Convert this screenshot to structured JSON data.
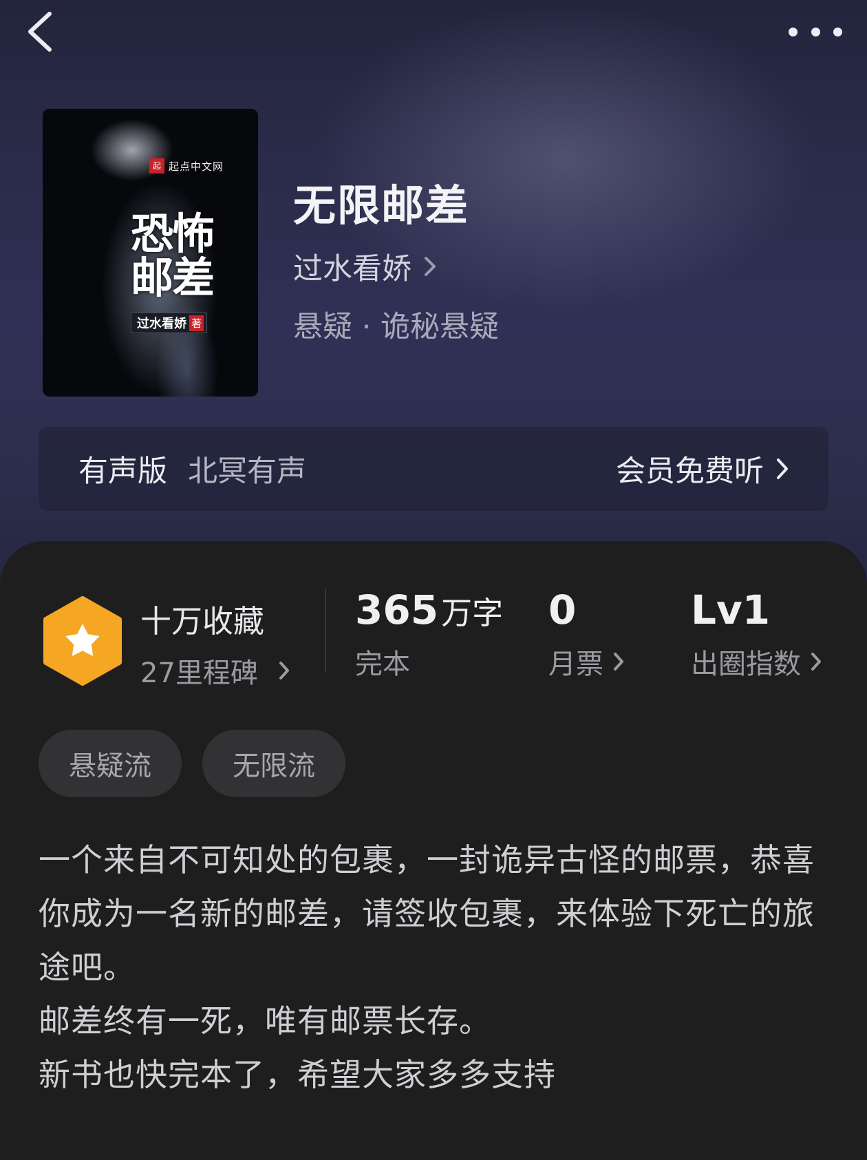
{
  "book": {
    "title": "无限邮差",
    "author": "过水看娇",
    "genre": "悬疑 · 诡秘悬疑",
    "cover": {
      "brand": "起点中文网",
      "brand_mark": "起",
      "title": "恐怖邮差",
      "author": "过水看娇",
      "author_suffix": "著"
    }
  },
  "audio": {
    "label": "有声版",
    "narrator": "北冥有声",
    "cta": "会员免费听"
  },
  "stats": {
    "collection": {
      "title": "十万收藏",
      "subtitle": "27里程碑"
    },
    "word_count": {
      "value": "365",
      "unit": "万字",
      "label": "完本"
    },
    "monthly_tickets": {
      "value": "0",
      "label": "月票"
    },
    "influence": {
      "value": "Lv1",
      "label": "出圈指数"
    }
  },
  "tags": [
    "悬疑流",
    "无限流"
  ],
  "synopsis": [
    "一个来自不可知处的包裹，一封诡异古怪的邮票，恭喜你成为一名新的邮差，请签收包裹，来体验下死亡的旅途吧。",
    "邮差终有一死，唯有邮票长存。",
    "新书也快完本了，希望大家多多支持"
  ],
  "colors": {
    "header_bg": "#2b2c4a",
    "content_bg": "#1e1e1f",
    "badge_orange": "#f5a623",
    "tag_bg": "#323234"
  },
  "icons": {
    "back": "chevron-left-icon",
    "more": "more-dots-icon",
    "badge": "star-hexagon-icon",
    "chevron": "chevron-right-icon"
  }
}
